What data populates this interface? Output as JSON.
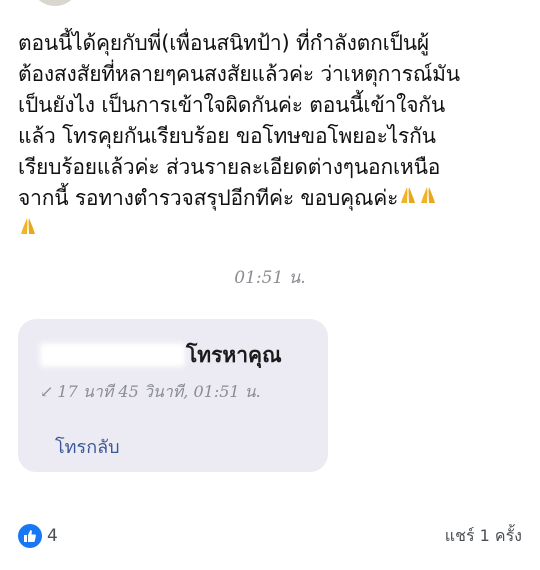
{
  "post": {
    "text_lines": [
      "ตอนนี้ได้คุยกับพี่(เพื่อนสนิทป้า) ที่กำลังตกเป็นผู้",
      "ต้องสงสัยที่หลายๆคนสงสัยแล้วค่ะ ว่าเหตุการณ์มัน",
      "เป็นยังไง เป็นการเข้าใจผิดกันค่ะ ตอนนี้เข้าใจกัน",
      "แล้ว โทรคุยกันเรียบร้อย ขอโทษขอโพยอะไรกัน",
      "เรียบร้อยแล้วค่ะ ส่วนรายละเอียดต่างๆนอกเหนือ",
      "จากนี้ รอทางตำรวจสรุปอีกทีค่ะ ขอบคุณค่ะ"
    ],
    "emoji_icon": "folded-hands-icon"
  },
  "chat": {
    "timestamp": "01:51 น.",
    "call": {
      "title": "โทรหาคุณ",
      "details": "17 นาที 45 วินาที, 01:51 น.",
      "direction_icon": "incoming-arrow-icon",
      "callback_label": "โทรกลับ"
    }
  },
  "footer": {
    "like_icon": "thumbs-up-icon",
    "like_count": "4",
    "shares_label": "แชร์ 1 ครั้ง"
  },
  "colors": {
    "link": "#3b5998",
    "like_badge": "#1877f2",
    "card_bg": "#ecebf3",
    "muted_text": "#8a8d91"
  }
}
